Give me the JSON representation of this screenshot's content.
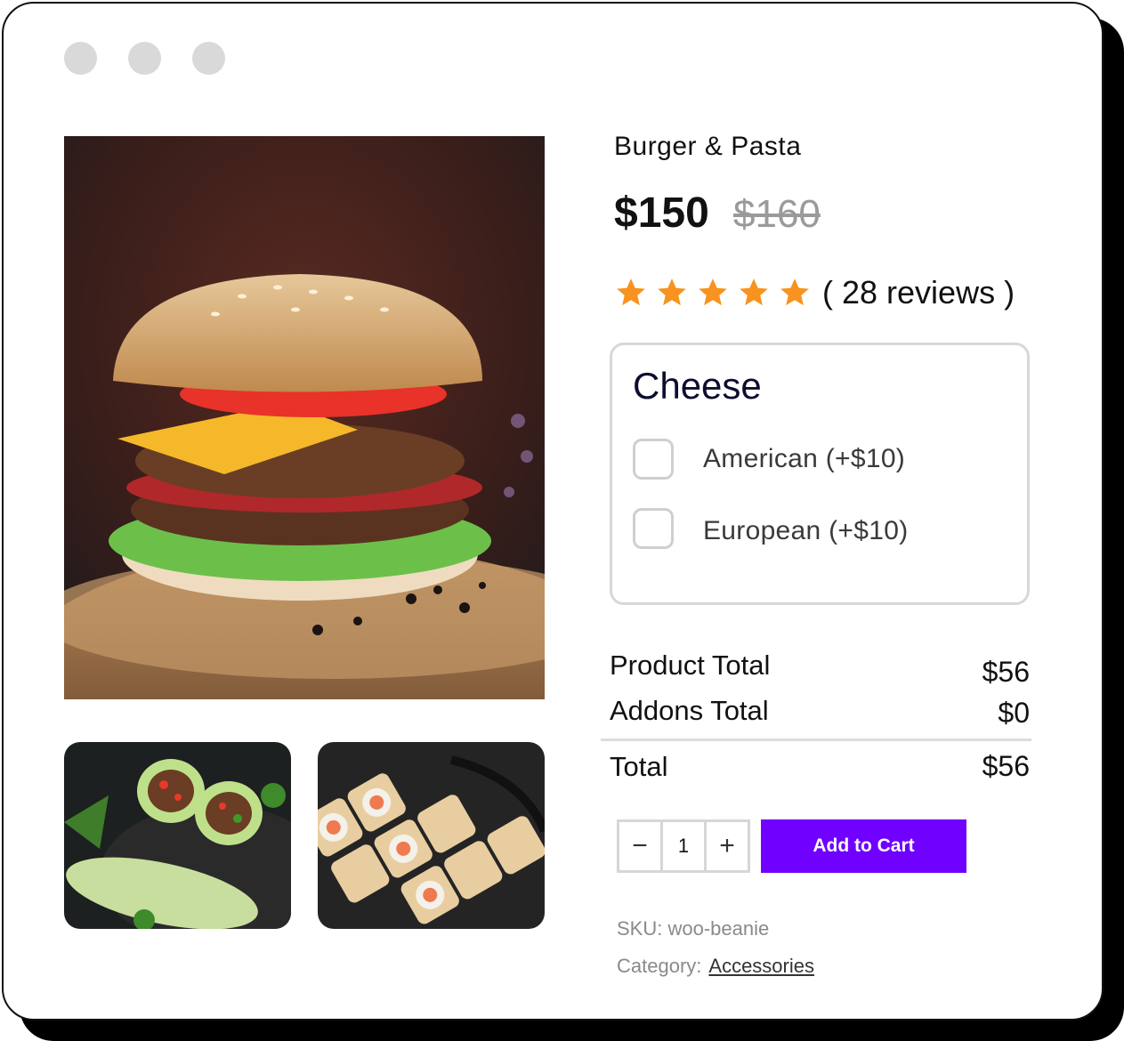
{
  "window": {
    "controls": [
      "dot",
      "dot",
      "dot"
    ]
  },
  "gallery": {
    "main_image": "burger-photo",
    "thumbnails": [
      "wraps-photo",
      "sushi-photo"
    ]
  },
  "product": {
    "title": "Burger & Pasta",
    "price": "$150",
    "old_price": "$160",
    "rating": 5,
    "rating_max": 5,
    "reviews_text": "( 28 reviews )",
    "star_color": "#f7931e"
  },
  "addons": {
    "title": "Cheese",
    "options": [
      {
        "label": "American (+$10)",
        "checked": false
      },
      {
        "label": "European (+$10)",
        "checked": false
      }
    ]
  },
  "totals": {
    "product_total_label": "Product Total",
    "product_total_value": "$56",
    "addons_total_label": "Addons Total",
    "addons_total_value": "$0",
    "total_label": "Total",
    "total_value": "$56"
  },
  "cart": {
    "minus": "−",
    "quantity": "1",
    "plus": "+",
    "button_label": "Add to Cart",
    "button_color": "#7000ff"
  },
  "meta": {
    "sku": "SKU: woo-beanie",
    "category_label": "Category:",
    "category_value": "Accessories"
  }
}
